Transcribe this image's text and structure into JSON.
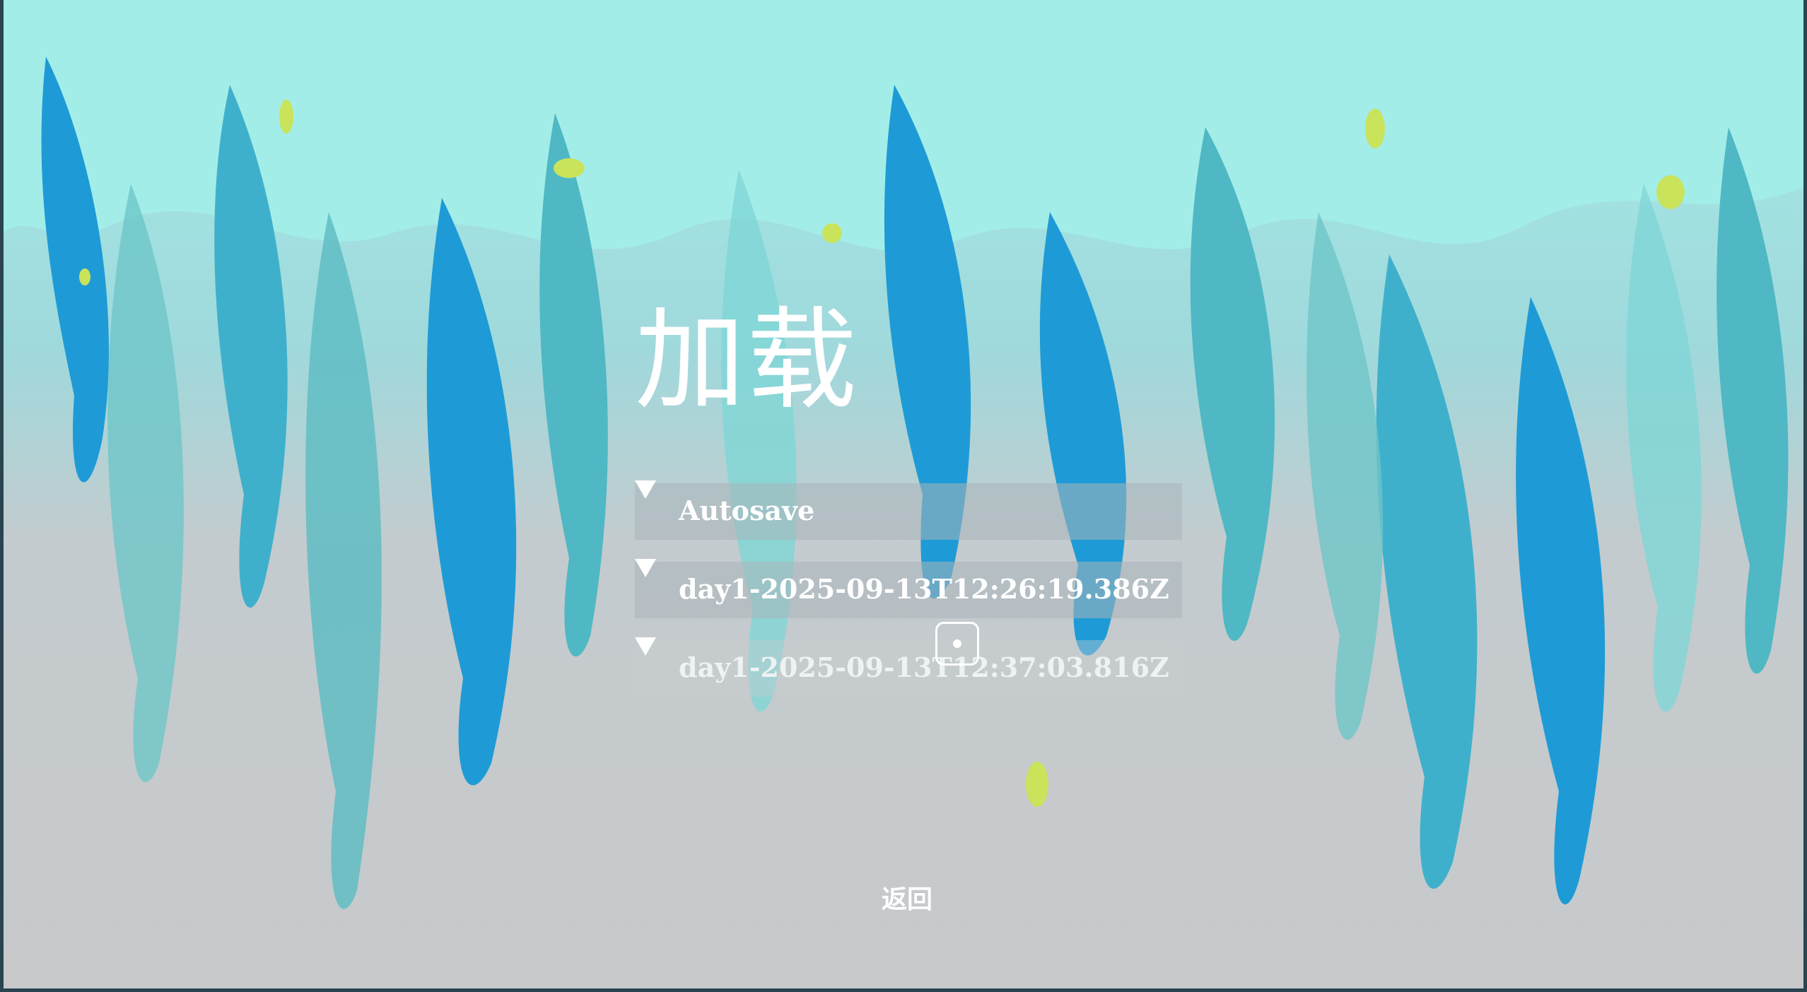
{
  "screen": {
    "title": "加载",
    "back_label": "返回"
  },
  "saves": [
    {
      "label": "Autosave"
    },
    {
      "label": "day1-2025-09-13T12:26:19.386Z"
    },
    {
      "label": "day1-2025-09-13T12:37:03.816Z"
    }
  ],
  "colors": {
    "foliage_light": "#93e8e4",
    "foliage_mid": "#4fb8c4",
    "foliage_blue": "#1e9bd6",
    "background": "#c6c9cb",
    "frame": "#2a4450",
    "text": "#ffffff"
  }
}
